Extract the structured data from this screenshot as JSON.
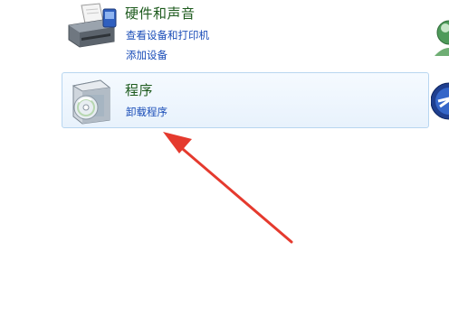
{
  "categories": {
    "hardware": {
      "title": "硬件和声音",
      "links": [
        "查看设备和打印机",
        "添加设备"
      ],
      "icon": "printer-icon"
    },
    "programs": {
      "title": "程序",
      "links": [
        "卸载程序"
      ],
      "icon": "programs-disc-icon"
    }
  },
  "colors": {
    "title_green": "#1e5b1e",
    "link_blue": "#1a4db8",
    "highlight_border": "#b8d6f0",
    "arrow_red": "#e53a2e"
  },
  "annotations": {
    "arrow": "red-annotation-arrow"
  }
}
